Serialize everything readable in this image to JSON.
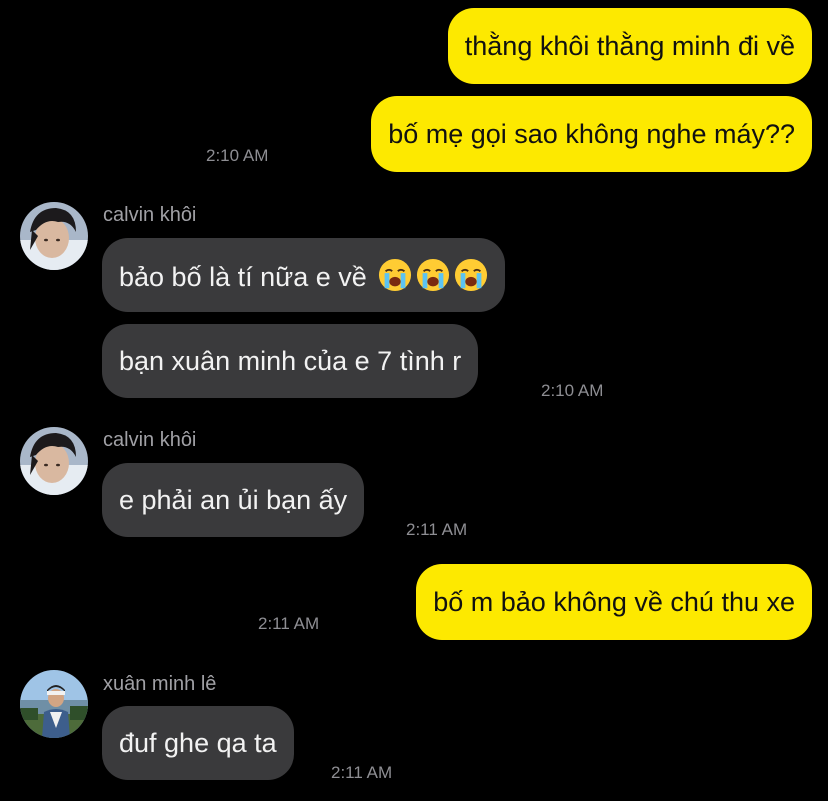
{
  "colors": {
    "background": "#000000",
    "outgoing_bubble": "#fde900",
    "incoming_bubble": "#3a3a3c",
    "timestamp": "#8e8e93"
  },
  "messages": [
    {
      "direction": "outgoing",
      "text": "thằng khôi thằng minh đi về"
    },
    {
      "direction": "outgoing",
      "text": "bố mẹ gọi sao không nghe máy??",
      "time": "2:10 AM"
    },
    {
      "direction": "incoming",
      "sender": "calvin khôi",
      "text": "bảo bố là tí nữa e về",
      "emoji": [
        "loudly-crying-face",
        "loudly-crying-face",
        "loudly-crying-face"
      ]
    },
    {
      "direction": "incoming",
      "text": "bạn xuân minh của e 7 tình r",
      "time": "2:10 AM"
    },
    {
      "direction": "incoming",
      "sender": "calvin khôi",
      "text": "e phải an ủi bạn ấy",
      "time": "2:11 AM"
    },
    {
      "direction": "outgoing",
      "text": "bố m bảo không về chú thu xe",
      "time": "2:11 AM"
    },
    {
      "direction": "incoming",
      "sender": "xuân minh lê",
      "text": "đuf ghe qa ta",
      "time": "2:11 AM"
    }
  ]
}
